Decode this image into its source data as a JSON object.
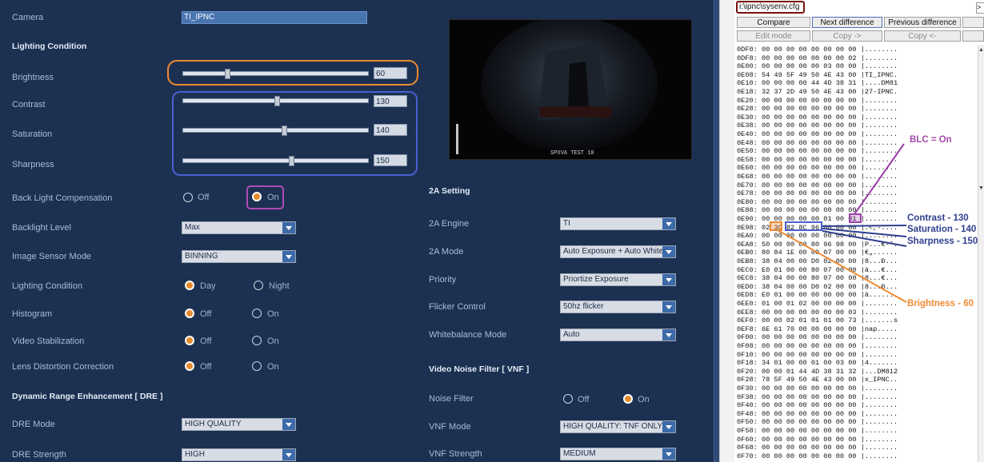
{
  "camera": {
    "label": "Camera",
    "name": "TI_IPNC"
  },
  "sections": {
    "lighting": "Lighting Condition",
    "dre": "Dynamic Range Enhancement [ DRE ]",
    "twoa": "2A Setting",
    "vnf": "Video Noise Filter [ VNF ]"
  },
  "sliders": [
    {
      "label": "Brightness",
      "value": "60",
      "fraction": 0.235
    },
    {
      "label": "Contrast",
      "value": "130",
      "fraction": 0.51
    },
    {
      "label": "Saturation",
      "value": "140",
      "fraction": 0.549
    },
    {
      "label": "Sharpness",
      "value": "150",
      "fraction": 0.588
    }
  ],
  "blc": {
    "label": "Back Light Compensation",
    "off": "Off",
    "on": "On",
    "selected": "On"
  },
  "backlight_level": {
    "label": "Backlight Level",
    "value": "Max"
  },
  "sensor_mode": {
    "label": "Image Sensor Mode",
    "value": "BINNING"
  },
  "lighting_cond": {
    "label": "Lighting Condition",
    "opt1": "Day",
    "opt2": "Night",
    "selected": "Day"
  },
  "histogram": {
    "label": "Histogram",
    "off": "Off",
    "on": "On",
    "selected": "Off"
  },
  "video_stab": {
    "label": "Video Stabilization",
    "off": "Off",
    "on": "On",
    "selected": "Off"
  },
  "lens_dist": {
    "label": "Lens Distortion Correction",
    "off": "Off",
    "on": "On",
    "selected": "Off"
  },
  "dre_mode": {
    "label": "DRE Mode",
    "value": "HIGH QUALITY"
  },
  "dre_strength": {
    "label": "DRE Strength",
    "value": "HIGH"
  },
  "twoa_engine": {
    "label": "2A Engine",
    "value": "TI"
  },
  "twoa_mode": {
    "label": "2A Mode",
    "value": "Auto Exposure + Auto White"
  },
  "priority": {
    "label": "Priority",
    "value": "Priortize Exposure"
  },
  "flicker": {
    "label": "Flicker Control",
    "value": "50hz flicker"
  },
  "wb_mode": {
    "label": "Whitebalance Mode",
    "value": "Auto"
  },
  "noise_filter": {
    "label": "Noise Filter",
    "off": "Off",
    "on": "On",
    "selected": "On"
  },
  "vnf_mode": {
    "label": "VNF Mode",
    "value": "HIGH QUALITY: TNF ONLY"
  },
  "vnf_strength": {
    "label": "VNF Strength",
    "value": "MEDIUM"
  },
  "preview": {
    "overlay": "SPXVA TEST 18"
  },
  "hex": {
    "path": "i:\\ipnc\\sysenv.cfg",
    "buttons": {
      "compare": "Compare",
      "next": "Next difference",
      "prev": "Previous difference",
      "edit": "Edit mode",
      "copy_right": "Copy ->",
      "copy_left": "Copy <-"
    },
    "rows": [
      "0DF0: 00 00 00 00 00 00 00 00 |........",
      "0DF8: 00 00 00 00 00 00 00 02 |........",
      "0E00: 00 00 00 00 00 03 00 00 |........",
      "0E08: 54 49 5F 49 50 4E 43 00 |TI_IPNC.",
      "0E10: 00 00 00 00 44 4D 38 31 |....DM81",
      "0E18: 32 37 2D 49 50 4E 43 00 |27-IPNC.",
      "0E20: 00 00 00 00 00 00 00 00 |........",
      "0E28: 00 00 00 00 00 00 00 00 |........",
      "0E30: 00 00 00 00 00 00 00 00 |........",
      "0E38: 00 00 00 00 00 00 00 00 |........",
      "0E40: 00 00 00 00 00 00 00 00 |........",
      "0E48: 00 00 00 00 00 00 00 00 |........",
      "0E50: 00 00 00 00 00 00 00 00 |........",
      "0E58: 00 00 00 00 00 00 00 00 |........",
      "0E60: 00 00 00 00 00 00 00 00 |........",
      "0E68: 00 00 00 00 00 00 00 00 |........",
      "0E70: 00 00 00 00 00 00 00 00 |........",
      "0E78: 00 00 00 00 00 00 00 00 |........",
      "0E80: 00 00 00 00 00 00 00 00 |........",
      "0E88: 00 00 00 00 00 00 00 00 |........",
      "0E90: 00 00 00 00 00 01 00 01 |........",
      "0E98: 02 3C 82 8C 96 00 00 00 |.<,-....",
      "0EA0: 00 00 00 00 00 00 00 00 |........",
      "0EA8: 50 00 00 00 80 96 98 00 |P...€-˜.",
      "0EB0: 80 84 1E 00 00 07 00 00 |€„......",
      "0EB8: 38 04 00 00 D0 02 00 00 |8...Ð...",
      "0EC0: E0 01 00 00 80 07 00 00 |à...€...",
      "0EC8: 38 04 00 00 80 07 00 00 |8...€...",
      "0ED0: 38 04 00 00 D0 02 00 00 |8...Ð...",
      "0ED8: E0 01 00 00 00 00 00 00 |à.......",
      "0EE0: 01 00 01 02 00 00 00 00 |........",
      "0EE8: 00 00 00 00 00 00 00 03 |........",
      "0EF0: 00 00 02 01 01 01 00 73 |.......s",
      "0EF8: 6E 61 70 00 00 00 00 00 |nap.....",
      "0F00: 00 00 00 00 00 00 00 00 |........",
      "0F08: 00 00 00 00 00 00 00 00 |........",
      "0F10: 00 00 00 00 00 00 00 00 |........",
      "0F18: 34 01 00 00 01 00 03 00 |4.......",
      "0F20: 00 00 01 44 4D 38 31 32 |...DM812",
      "0F28: 78 5F 49 50 4E 43 00 00 |x_IPNC..",
      "0F30: 00 00 00 00 00 00 00 00 |........",
      "0F38: 00 00 00 00 00 00 00 00 |........",
      "0F40: 00 00 00 00 00 00 00 00 |........",
      "0F48: 00 00 00 00 00 00 00 00 |........",
      "0F50: 00 00 00 00 00 00 00 00 |........",
      "0F58: 00 00 00 00 00 00 00 00 |........",
      "0F60: 00 00 00 00 00 00 00 00 |........",
      "0F68: 00 00 00 00 00 00 00 00 |........",
      "0F70: 00 00 00 00 00 00 00 00 |........"
    ]
  },
  "annotations": {
    "blc": "BLC = On",
    "contrast": "Contrast - 130",
    "saturation": "Saturation - 140",
    "sharpness": "Sharpness - 150",
    "brightness": "Brightness - 60"
  },
  "colors": {
    "panel_bg": "#1c3151",
    "orange": "#ef8a33",
    "blue": "#4a5fd0",
    "purple": "#b04ab8",
    "navy_text": "#2e3f8f"
  }
}
